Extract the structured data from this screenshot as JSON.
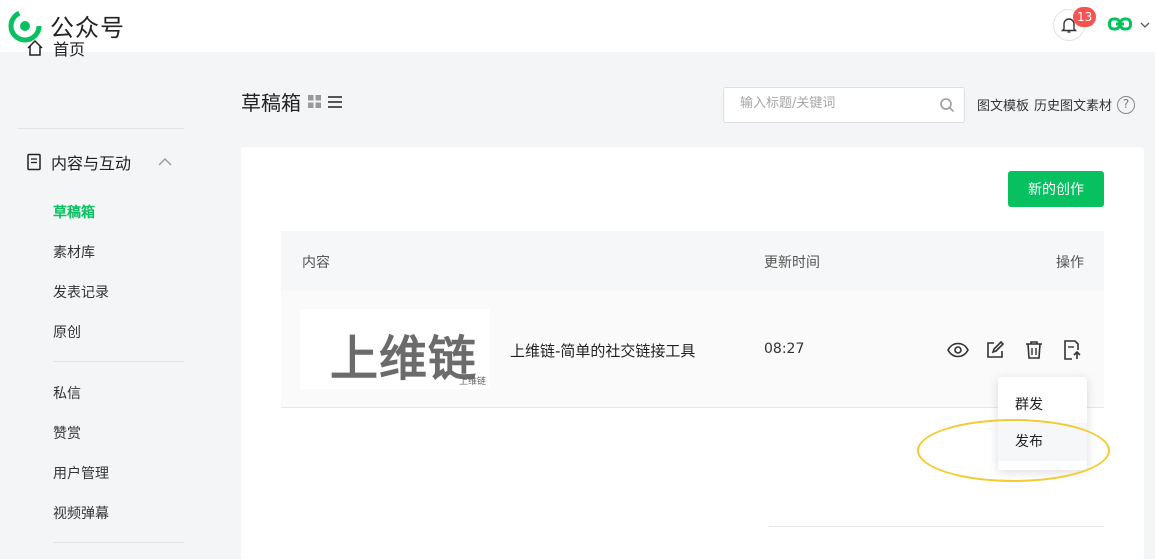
{
  "app": {
    "name": "公众号"
  },
  "header": {
    "notification_count": "13"
  },
  "sidebar": {
    "home": "首页",
    "section": "内容与互动",
    "items": [
      {
        "label": "草稿箱",
        "active": true
      },
      {
        "label": "素材库"
      },
      {
        "label": "发表记录"
      },
      {
        "label": "原创"
      },
      {
        "label": "私信"
      },
      {
        "label": "赞赏"
      },
      {
        "label": "用户管理"
      },
      {
        "label": "视频弹幕"
      }
    ]
  },
  "page": {
    "title": "草稿箱",
    "search_placeholder": "输入标题/关键词",
    "template_link": "图文模板",
    "history_link": "历史图文素材",
    "help": "?",
    "new_button": "新的创作"
  },
  "table": {
    "columns": [
      "内容",
      "更新时间",
      "操作"
    ],
    "rows": [
      {
        "thumb_text": "上维链",
        "thumb_watermark": "上维链",
        "title": "上维链-简单的社交链接工具",
        "time": "08:27"
      }
    ]
  },
  "dropdown": {
    "options": [
      "群发",
      "发布"
    ]
  },
  "colors": {
    "accent": "#07c160",
    "badge": "#fa5151",
    "highlight": "#f2cb34"
  }
}
